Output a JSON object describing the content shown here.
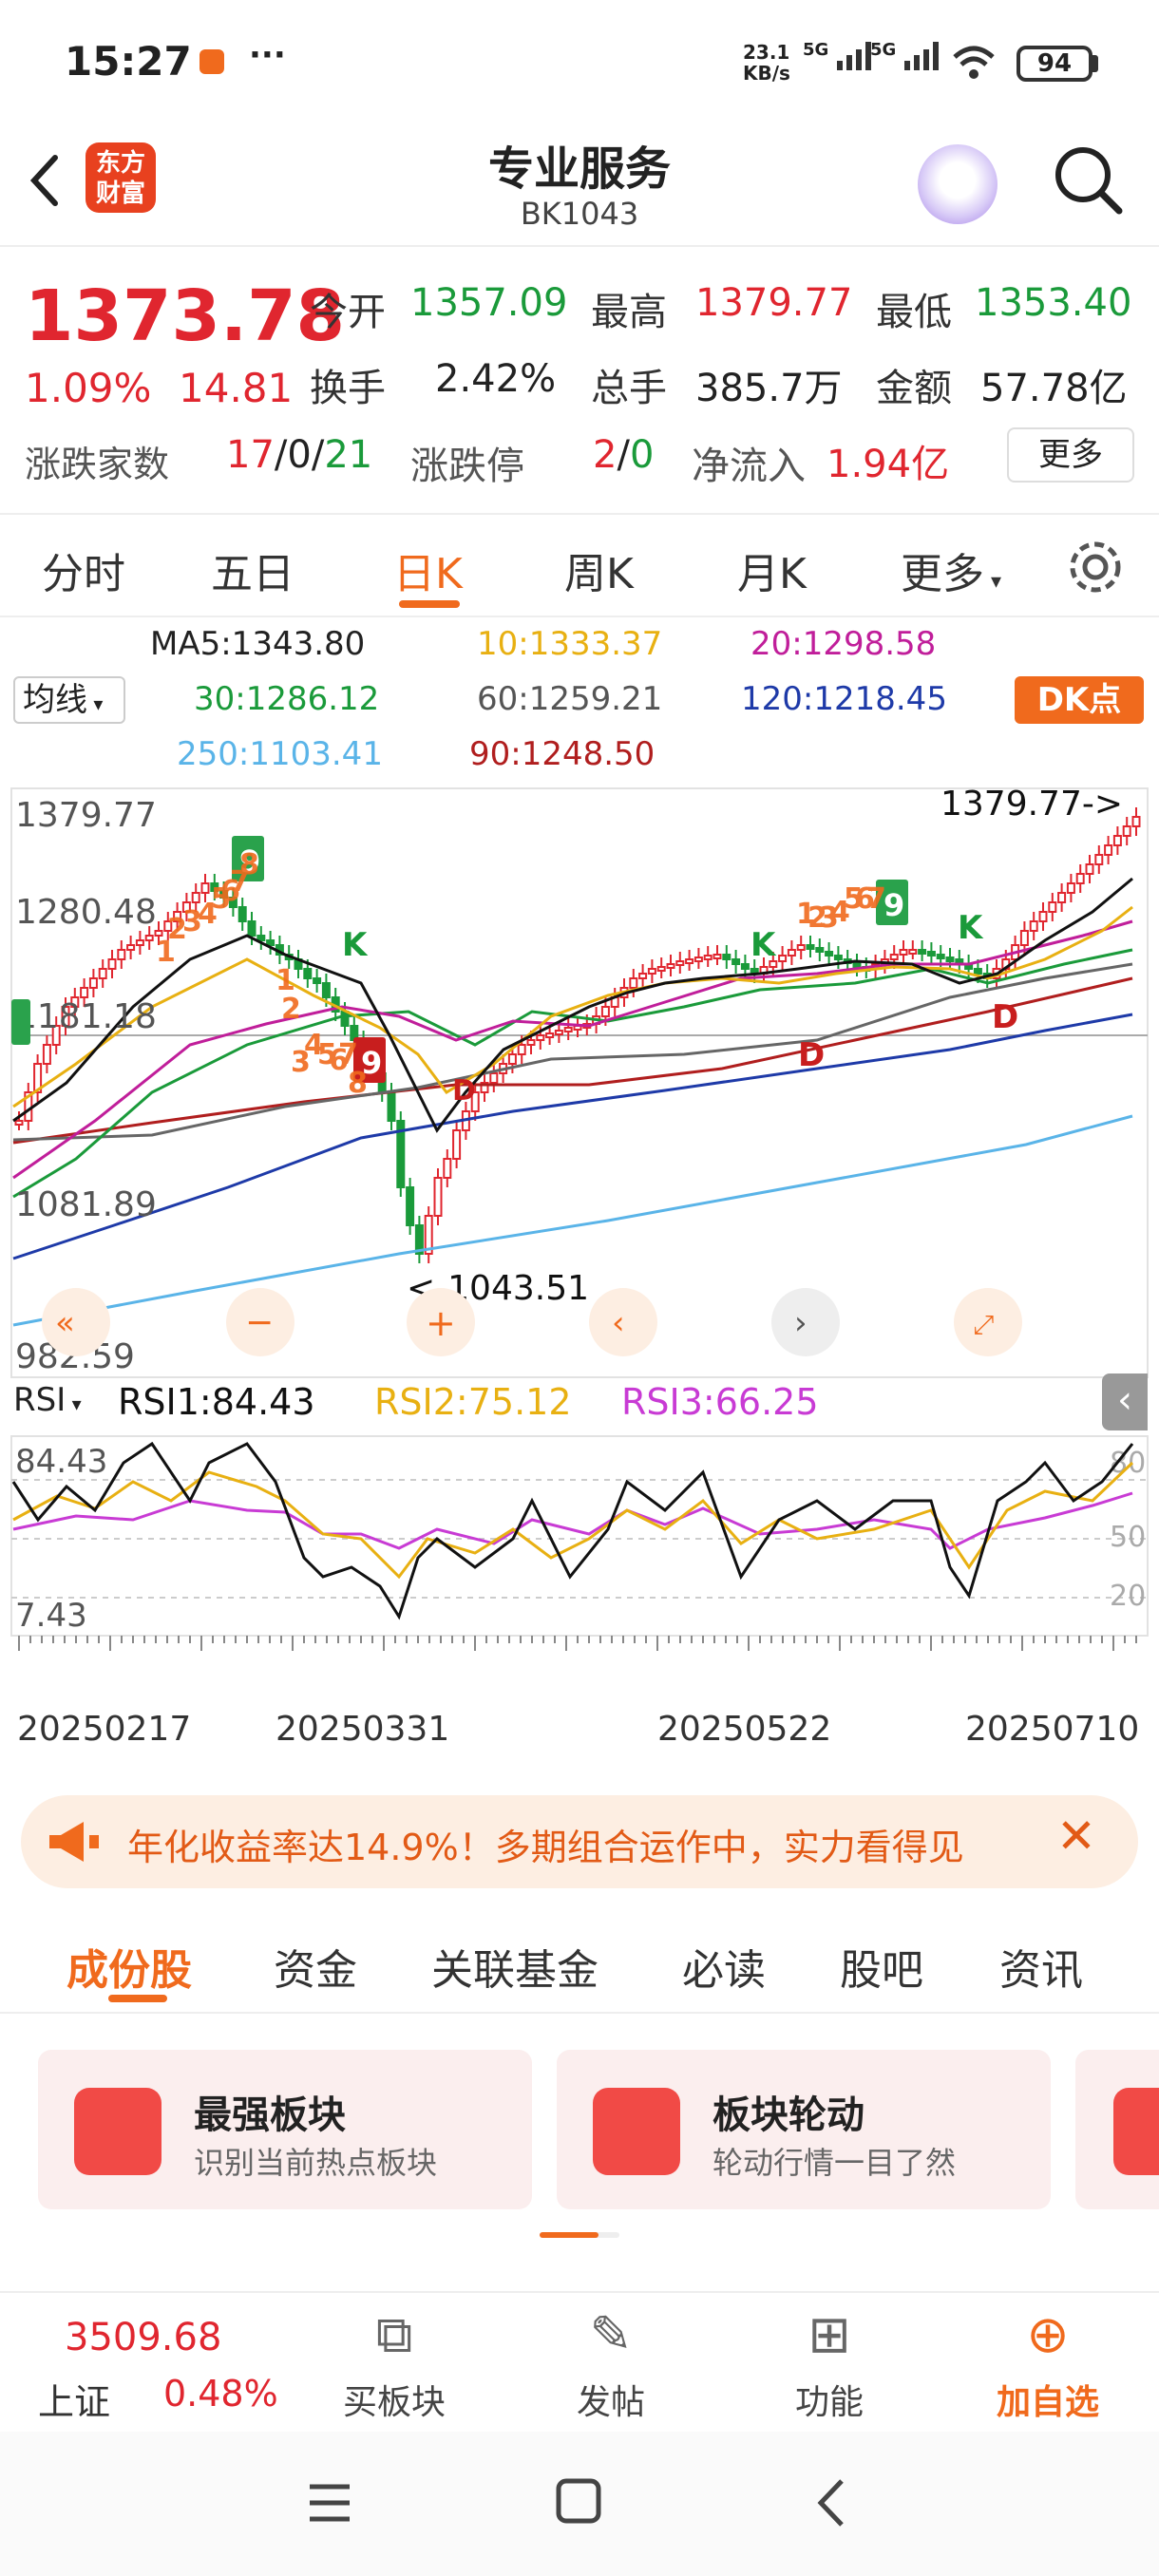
{
  "status_bar": {
    "time": "15:27",
    "net_speed_value": "23.1",
    "net_speed_unit": "KB/s",
    "signal1": "5G",
    "signal2": "5G",
    "battery": "94"
  },
  "header": {
    "logo": "东方财富",
    "title": "专业服务",
    "code": "BK1043"
  },
  "quote": {
    "price": "1373.78",
    "change_pct": "1.09%",
    "change": "14.81",
    "open_label": "今开",
    "open": "1357.09",
    "high_label": "最高",
    "high": "1379.77",
    "low_label": "最低",
    "low": "1353.40",
    "turnover_label": "换手",
    "turnover": "2.42%",
    "volume_label": "总手",
    "volume": "385.7万",
    "amount_label": "金额",
    "amount": "57.78亿",
    "breadth_label": "涨跌家数",
    "up": "17",
    "flat": "0",
    "down": "21",
    "limit_label": "涨跌停",
    "limit_up": "2",
    "limit_down": "0",
    "inflow_label": "净流入",
    "inflow": "1.94亿",
    "more": "更多"
  },
  "period_tabs": [
    "分时",
    "五日",
    "日K",
    "周K",
    "月K",
    "更多"
  ],
  "ma": {
    "select": "均线",
    "ma5": "MA5:1343.80",
    "ma10": "10:1333.37",
    "ma20": "20:1298.58",
    "ma30": "30:1286.12",
    "ma60": "60:1259.21",
    "ma120": "120:1218.45",
    "ma250": "250:1103.41",
    "ma90": "90:1248.50",
    "dk": "DK点"
  },
  "chart_labels": {
    "y1": "1379.77",
    "y2": "1280.48",
    "y3": "1181.18",
    "y4": "1081.89",
    "y5": "982.59",
    "high_marker": "1379.77->",
    "low_marker": "<-1043.51",
    "rsi_top": "84.43",
    "rsi_bottom": "7.43",
    "rsi_80": "80",
    "rsi_50": "50",
    "rsi_20": "20",
    "k_label": "K",
    "d_label": "D",
    "nine": "9"
  },
  "rsi": {
    "select": "RSI",
    "rsi1": "RSI1:84.43",
    "rsi2": "RSI2:75.12",
    "rsi3": "RSI3:66.25"
  },
  "dates": [
    "20250217",
    "20250331",
    "20250522",
    "20250710"
  ],
  "marquee": "年化收益率达14.9%！多期组合运作中，实力看得见",
  "content_tabs": [
    "成份股",
    "资金",
    "关联基金",
    "必读",
    "股吧",
    "资讯"
  ],
  "cards": [
    {
      "title": "最强板块",
      "sub": "识别当前热点板块"
    },
    {
      "title": "板块轮动",
      "sub": "轮动行情一目了然"
    }
  ],
  "bottom": {
    "index_value": "3509.68",
    "index_name": "上证",
    "index_change": "0.48%",
    "buy": "买板块",
    "post": "发帖",
    "func": "功能",
    "add": "加自选"
  },
  "chart_data": {
    "type": "line",
    "title": "",
    "x": [
      "20250217",
      "20250331",
      "20250522",
      "20250710"
    ],
    "ylim": [
      982.59,
      1379.77
    ],
    "series": [
      {
        "name": "MA5",
        "values": [
          1343.8
        ]
      },
      {
        "name": "10",
        "values": [
          1333.37
        ]
      },
      {
        "name": "20",
        "values": [
          1298.58
        ]
      },
      {
        "name": "30",
        "values": [
          1286.12
        ]
      },
      {
        "name": "60",
        "values": [
          1259.21
        ]
      },
      {
        "name": "120",
        "values": [
          1218.45
        ]
      },
      {
        "name": "250",
        "values": [
          1103.41
        ]
      },
      {
        "name": "90",
        "values": [
          1248.5
        ]
      }
    ],
    "high": 1379.77,
    "low": 1043.51,
    "rsi": {
      "RSI1": 84.43,
      "RSI2": 75.12,
      "RSI3": 66.25,
      "ylim": [
        7.43,
        84.43
      ]
    },
    "colors": {
      "up": "#e0262f",
      "down": "#1a9a3a",
      "ma5": "#222222",
      "ma10": "#e8b012",
      "ma20": "#c01e9a",
      "ma30": "#1a9a3a",
      "ma60": "#666666",
      "ma120": "#1e3aa8",
      "ma250": "#5ab4e8",
      "ma90": "#b01e1e"
    }
  }
}
